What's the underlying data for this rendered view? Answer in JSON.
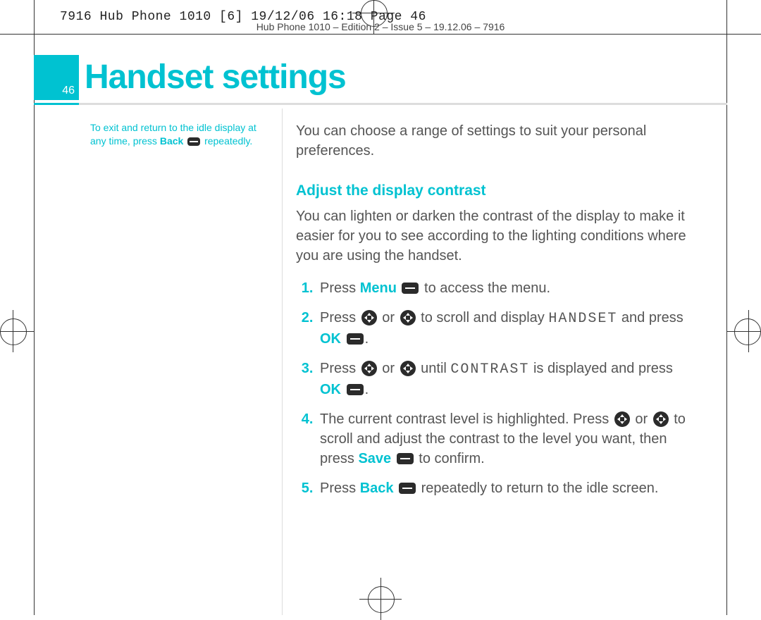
{
  "print_header": "7916 Hub Phone 1010 [6]  19/12/06  16:18  Page 46",
  "edition_meta": "Hub Phone 1010 – Edition 2 – Issue 5 – 19.12.06 – 7916",
  "page_number": "46",
  "page_title": "Handset settings",
  "side_note": {
    "line1": "To exit and return to the idle display at",
    "line2a": "any time, press ",
    "back": "Back",
    "line2b": " repeatedly."
  },
  "intro": "You can choose a range of settings to suit your personal preferences.",
  "section_heading": "Adjust the display contrast",
  "section_intro": "You can lighten or darken the contrast of the display to make it easier for you to see according to the lighting conditions where you are using the handset.",
  "steps": {
    "s1": {
      "a": "Press ",
      "menu": "Menu",
      "b": " to access the menu."
    },
    "s2": {
      "a": "Press ",
      "b": " or ",
      "c": " to scroll and display ",
      "handset": "HANDSET",
      "d": " and press ",
      "ok": "OK",
      "e": "."
    },
    "s3": {
      "a": "Press ",
      "b": " or ",
      "c": " until ",
      "contrast": "CONTRAST",
      "d": " is displayed and press ",
      "ok": "OK",
      "e": "."
    },
    "s4": {
      "a": "The current contrast level is highlighted. Press ",
      "b": " or ",
      "c": " to scroll and adjust the contrast to the level you want, then press ",
      "save": "Save",
      "d": " to confirm."
    },
    "s5": {
      "a": "Press ",
      "back": "Back",
      "b": " repeatedly to return to the idle screen."
    }
  }
}
